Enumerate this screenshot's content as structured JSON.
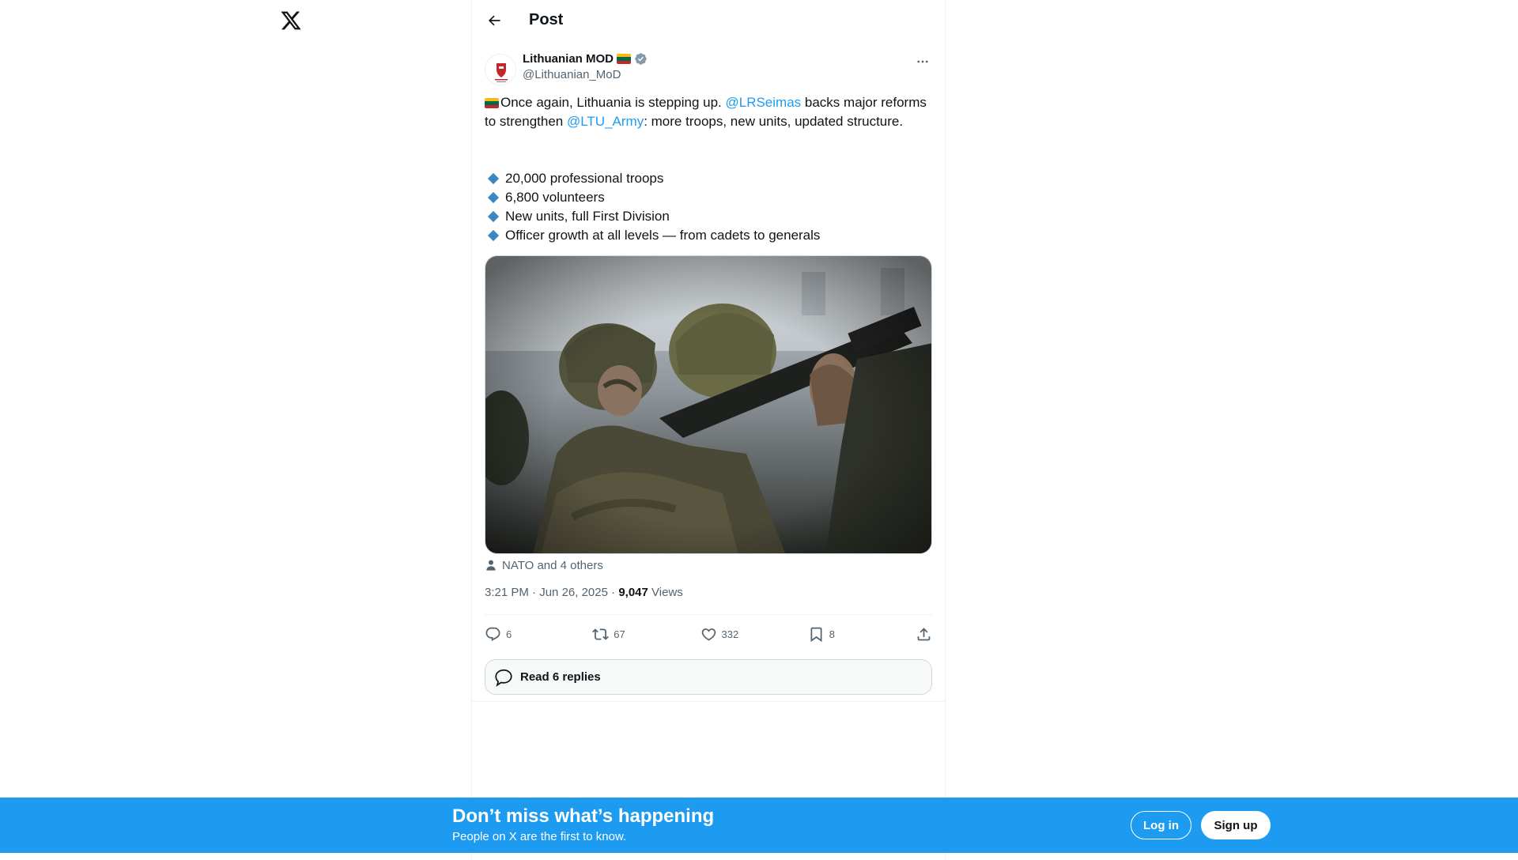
{
  "app": {
    "logo_icon": "x-logo-icon"
  },
  "header": {
    "title": "Post",
    "back_icon": "arrow-left-icon"
  },
  "post": {
    "author": {
      "name": "Lithuanian MOD",
      "handle": "@Lithuanian_MoD",
      "verified": true,
      "flag_colors": [
        "#fdb913",
        "#006a44",
        "#c1272d"
      ]
    },
    "text": {
      "part1": "Once again, Lithuania is stepping up. ",
      "mention1": "@LRSeimas",
      "part2": " backs major reforms to strengthen ",
      "mention2": "@LTU_Army",
      "part3": ": more troops, new units, updated structure."
    },
    "bullets": [
      "20,000 professional troops",
      "6,800 volunteers",
      "New units, full First Division",
      "Officer growth at all levels — from cadets to generals"
    ],
    "tagged": "NATO and 4 others",
    "time": "3:21 PM",
    "date": "Jun 26, 2025",
    "views_count": "9,047",
    "views_label": "Views",
    "stats": {
      "replies": "6",
      "reposts": "67",
      "likes": "332",
      "bookmarks": "8"
    },
    "read_replies": "Read 6 replies"
  },
  "banner": {
    "title": "Don’t miss what’s happening",
    "subtitle": "People on X are the first to know.",
    "login": "Log in",
    "signup": "Sign up"
  },
  "colors": {
    "accent": "#1d9bf0",
    "text": "#0f1419",
    "muted": "#536471",
    "bullet": "#3b88c3"
  }
}
